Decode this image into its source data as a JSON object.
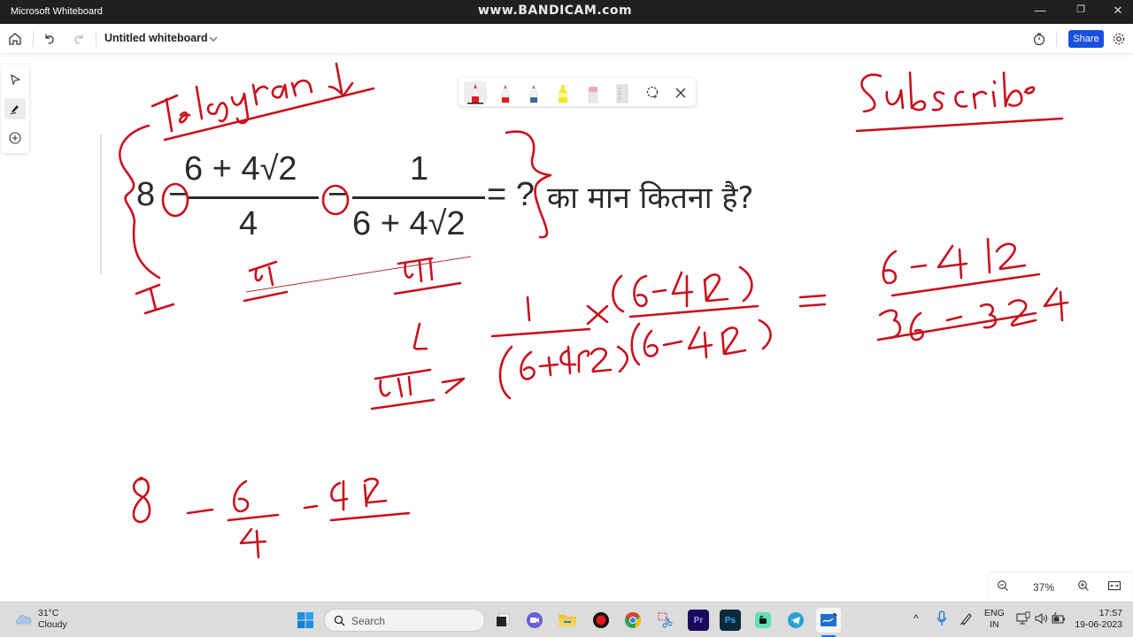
{
  "window": {
    "app_title": "Microsoft Whiteboard",
    "watermark": "www.BANDICAM.com",
    "controls": {
      "minimize": "—",
      "restore": "❐",
      "close": "✕"
    }
  },
  "toolbar": {
    "home_icon": "home-icon",
    "undo_icon": "undo-icon",
    "redo_icon": "redo-icon",
    "whiteboard_title": "Untitled whiteboard",
    "timer_icon": "timer-icon",
    "share_label": "Share",
    "settings_icon": "gear-icon"
  },
  "left_rail": {
    "items": [
      {
        "name": "select",
        "icon": "pointer-icon"
      },
      {
        "name": "inking",
        "icon": "pen-icon",
        "active": true
      },
      {
        "name": "add",
        "icon": "plus-circle-icon"
      }
    ]
  },
  "pen_tray": {
    "tools": [
      {
        "name": "red-pen-thick",
        "color": "#e31b23",
        "active": true
      },
      {
        "name": "red-pen",
        "color": "#e31b23"
      },
      {
        "name": "blue-pen",
        "color": "#2d5a8c"
      },
      {
        "name": "highlighter",
        "color": "#f5ea1a"
      },
      {
        "name": "eraser",
        "color": "#f0a8b8"
      },
      {
        "name": "ruler",
        "color": "#d0d0d0"
      }
    ],
    "lasso_icon": "lasso-icon",
    "close_icon": "close-icon"
  },
  "canvas": {
    "problem": {
      "lead": "8",
      "op1": "−",
      "frac1_num": "6 + 4√2",
      "frac1_den": "4",
      "op2": "−",
      "frac2_num": "1",
      "frac2_den": "6 + 4√2",
      "equals": "= ?",
      "hindi": "का मान कितना है?"
    },
    "ink_notes": {
      "telegram": "Telegram ↓",
      "subscribe": "Subscribe",
      "part_labels": [
        "I",
        "II",
        "III"
      ],
      "step_III": "III → 1/(6+4√2) × (6−4√2)/(6−4√2)",
      "result": "= (6 − 4√2)/(36 − 32) = (6 − 4√2)/4",
      "bottom": "8 − 6/4 − 4√2/"
    },
    "ink_color": "#c8101e"
  },
  "zoom_control": {
    "zoom_out_icon": "zoom-out-icon",
    "level": "37%",
    "zoom_in_icon": "zoom-in-icon",
    "fit_icon": "fit-to-screen-icon"
  },
  "taskbar": {
    "weather": {
      "temp": "31°C",
      "condition": "Cloudy"
    },
    "search_placeholder": "Search",
    "apps": [
      {
        "name": "start",
        "icon": "windows-start-icon"
      },
      {
        "name": "task-view",
        "icon": "task-view-icon"
      },
      {
        "name": "teams-meet",
        "icon": "video-chat-icon"
      },
      {
        "name": "file-explorer",
        "icon": "folder-icon"
      },
      {
        "name": "bandicam",
        "icon": "record-icon"
      },
      {
        "name": "chrome",
        "icon": "chrome-icon"
      },
      {
        "name": "snipping-tool",
        "icon": "scissors-icon"
      },
      {
        "name": "premiere-pro",
        "label": "Pr"
      },
      {
        "name": "photoshop",
        "label": "Ps"
      },
      {
        "name": "whatsapp-web",
        "icon": "chat-icon"
      },
      {
        "name": "telegram",
        "icon": "telegram-icon"
      },
      {
        "name": "whiteboard",
        "icon": "whiteboard-icon"
      }
    ],
    "tray": {
      "chevron": "^",
      "lang_top": "ENG",
      "lang_bottom": "IN",
      "time": "17:57",
      "date": "19-06-2023"
    }
  }
}
